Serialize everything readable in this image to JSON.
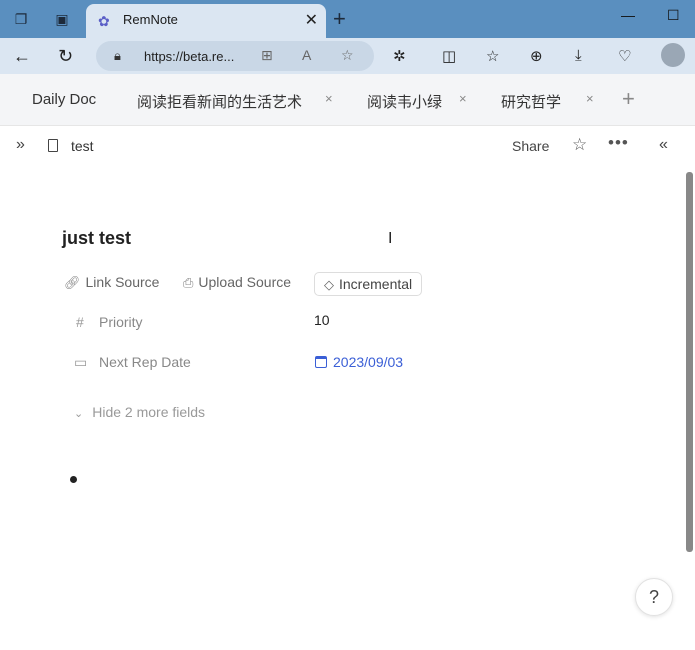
{
  "browser": {
    "tab_title": "RemNote",
    "tab_close": "✕",
    "new_tab": "+",
    "url": "https://beta.re...",
    "window_controls": {
      "minimize": "—",
      "maximize": "☐"
    }
  },
  "app_tabs": [
    {
      "label": "Daily Doc",
      "closable": false
    },
    {
      "label": "阅读拒看新闻的生活艺术",
      "closable": true
    },
    {
      "label": "阅读韦小绿",
      "closable": true
    },
    {
      "label": "研究哲学",
      "closable": true
    }
  ],
  "app_tab_close": "×",
  "app_add_tab": "+",
  "doc": {
    "name": "test",
    "share_label": "Share",
    "title": "just test"
  },
  "sources": {
    "link_source": "Link Source",
    "upload_source": "Upload Source",
    "incremental": "Incremental"
  },
  "fields": {
    "priority_label": "Priority",
    "priority_value": "10",
    "next_rep_label": "Next Rep Date",
    "next_rep_value": "2023/09/03",
    "hide_more": "Hide 2 more fields"
  },
  "help": "?",
  "colors": {
    "browser_accent": "#5a8fbf",
    "link_blue": "#3b5fd6"
  }
}
